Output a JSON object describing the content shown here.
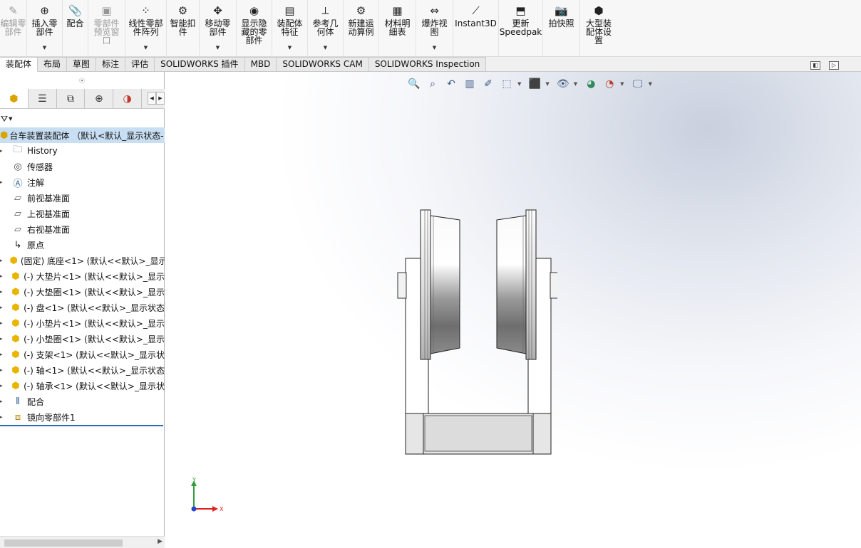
{
  "ribbon": {
    "buttons": [
      {
        "label": "编辑零\n部件",
        "icon": "edit-component-icon",
        "disabled": true
      },
      {
        "label": "插入零\n部件",
        "icon": "insert-component-icon",
        "disabled": false
      },
      {
        "label": "配合",
        "icon": "mate-icon",
        "disabled": false
      },
      {
        "label": "零部件\n预览窗\n口",
        "icon": "preview-window-icon",
        "disabled": true
      },
      {
        "label": "线性零部\n件阵列",
        "icon": "linear-pattern-icon",
        "disabled": false
      },
      {
        "label": "智能扣\n件",
        "icon": "smart-fastener-icon",
        "disabled": false
      },
      {
        "label": "移动零\n部件",
        "icon": "move-component-icon",
        "disabled": false
      },
      {
        "label": "显示隐\n藏的零\n部件",
        "icon": "show-hidden-icon",
        "disabled": false
      },
      {
        "label": "装配体\n特征",
        "icon": "assembly-feature-icon",
        "disabled": false
      },
      {
        "label": "参考几\n何体",
        "icon": "reference-geometry-icon",
        "disabled": false
      },
      {
        "label": "新建运\n动算例",
        "icon": "motion-study-icon",
        "disabled": false
      },
      {
        "label": "材料明\n细表",
        "icon": "bill-of-materials-icon",
        "disabled": false
      },
      {
        "label": "爆炸视\n图",
        "icon": "exploded-view-icon",
        "disabled": false
      },
      {
        "label": "Instant3D",
        "icon": "instant3d-icon",
        "disabled": false
      },
      {
        "label": "更新\nSpeedpak",
        "icon": "speedpak-icon",
        "disabled": false
      },
      {
        "label": "拍快照",
        "icon": "snapshot-icon",
        "disabled": false
      },
      {
        "label": "大型装\n配体设\n置",
        "icon": "large-assembly-icon",
        "disabled": false
      }
    ]
  },
  "tabs": [
    "装配体",
    "布局",
    "草图",
    "标注",
    "评估",
    "SOLIDWORKS 插件",
    "MBD",
    "SOLIDWORKS CAM",
    "SOLIDWORKS Inspection"
  ],
  "active_tab": 0,
  "tree": {
    "root": "台车装置装配体 （默认<默认_显示状态-1",
    "items": [
      {
        "label": "History",
        "icon": "history-folder-icon",
        "expand": true
      },
      {
        "label": "传感器",
        "icon": "sensor-icon",
        "expand": false
      },
      {
        "label": "注解",
        "icon": "annotation-icon",
        "expand": true
      },
      {
        "label": "前视基准面",
        "icon": "plane-icon",
        "expand": false
      },
      {
        "label": "上视基准面",
        "icon": "plane-icon",
        "expand": false
      },
      {
        "label": "右视基准面",
        "icon": "plane-icon",
        "expand": false
      },
      {
        "label": "原点",
        "icon": "origin-icon",
        "expand": false
      },
      {
        "label": "(固定) 底座<1> (默认<<默认>_显示",
        "icon": "part-icon",
        "expand": true
      },
      {
        "label": "(-) 大垫片<1> (默认<<默认>_显示",
        "icon": "part-icon",
        "expand": true
      },
      {
        "label": "(-) 大垫圈<1> (默认<<默认>_显示",
        "icon": "part-icon",
        "expand": true
      },
      {
        "label": "(-) 盘<1> (默认<<默认>_显示状态",
        "icon": "part-icon",
        "expand": true
      },
      {
        "label": "(-) 小垫片<1> (默认<<默认>_显示",
        "icon": "part-icon",
        "expand": true
      },
      {
        "label": "(-) 小垫圈<1> (默认<<默认>_显示",
        "icon": "part-icon",
        "expand": true
      },
      {
        "label": "(-) 支架<1> (默认<<默认>_显示状",
        "icon": "part-icon",
        "expand": true
      },
      {
        "label": "(-) 轴<1> (默认<<默认>_显示状态",
        "icon": "part-icon",
        "expand": true
      },
      {
        "label": "(-) 轴承<1> (默认<<默认>_显示状",
        "icon": "part-icon",
        "expand": true
      },
      {
        "label": "配合",
        "icon": "mates-folder-icon",
        "expand": true
      },
      {
        "label": "镜向零部件1",
        "icon": "mirror-component-icon",
        "expand": true
      }
    ]
  },
  "triad": {
    "x": "X",
    "y": "Y"
  },
  "colors": {
    "accent": "#2b6cb0",
    "selection": "#c8def2",
    "part_icon": "#e8b400"
  }
}
